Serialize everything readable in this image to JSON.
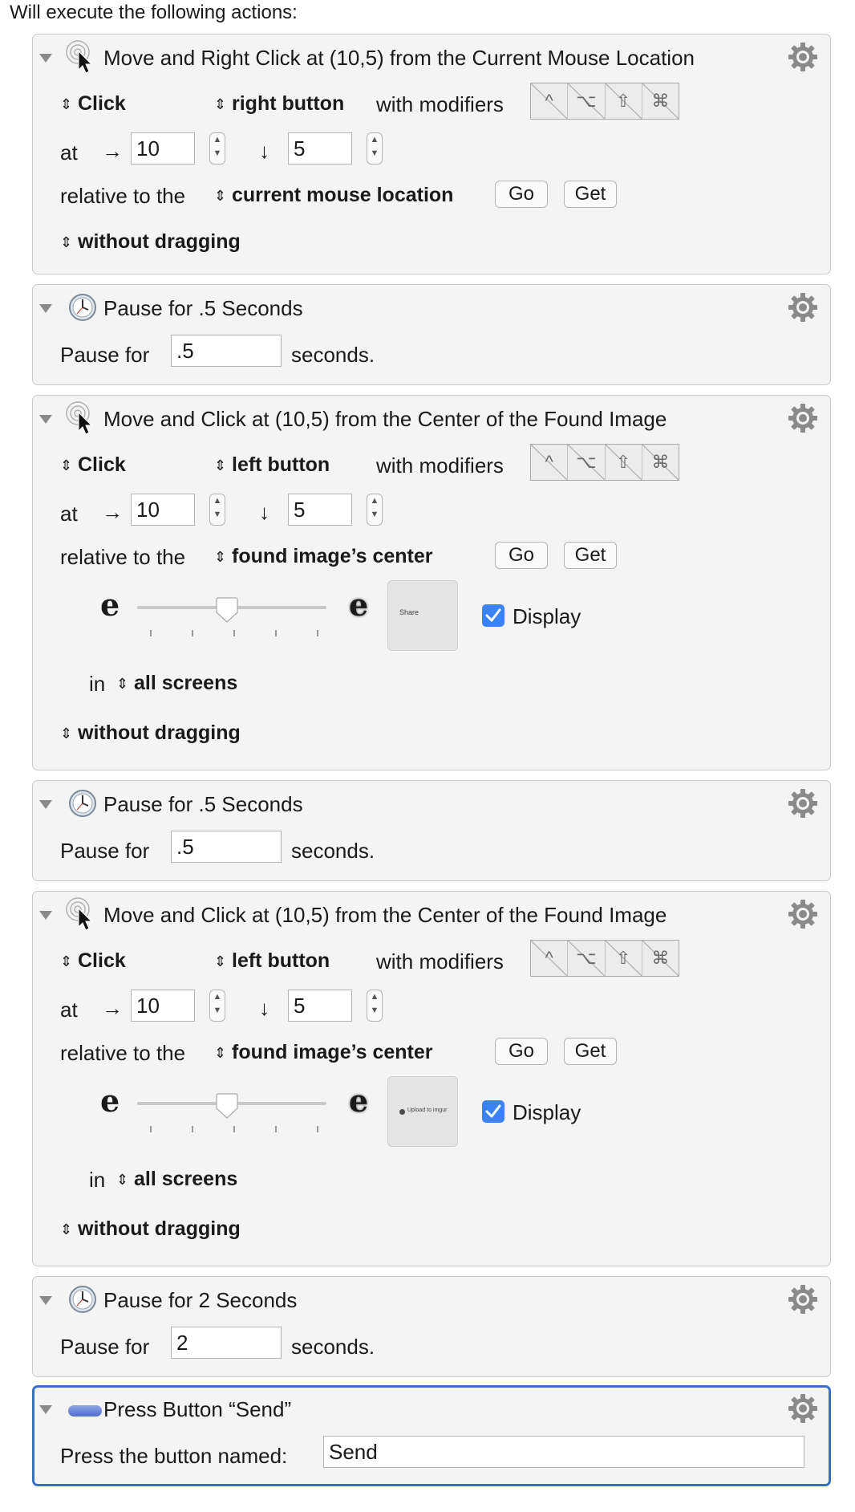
{
  "header": {
    "text": "Will execute the following actions:"
  },
  "actions": [
    {
      "title": "Move and Right Click at (10,5) from the Current Mouse Location",
      "click_mode": "Click",
      "button": "right button",
      "with_modifiers": "with modifiers",
      "modifiers": [
        "^",
        "⌥",
        "⇧",
        "⌘"
      ],
      "at_label": "at",
      "x_arrow": "→",
      "x_value": "10",
      "y_arrow": "↓",
      "y_value": "5",
      "relative_label": "relative to the",
      "relative_to": "current mouse location",
      "go": "Go",
      "get": "Get",
      "drag": "without dragging"
    },
    {
      "title": "Pause for .5 Seconds",
      "pause_label": "Pause for",
      "value": ".5",
      "unit": "seconds."
    },
    {
      "title": "Move and Click at (10,5) from the Center of the Found Image",
      "click_mode": "Click",
      "button": "left button",
      "with_modifiers": "with modifiers",
      "modifiers": [
        "^",
        "⌥",
        "⇧",
        "⌘"
      ],
      "at_label": "at",
      "x_arrow": "→",
      "x_value": "10",
      "y_arrow": "↓",
      "y_value": "5",
      "relative_label": "relative to the",
      "relative_to": "found image’s center",
      "go": "Go",
      "get": "Get",
      "fuzz_low": "e",
      "fuzz_high": "e",
      "image_text": "Share",
      "display_label": "Display",
      "display_checked": true,
      "in_label": "in",
      "screens": "all screens",
      "drag": "without dragging"
    },
    {
      "title": "Pause for .5 Seconds",
      "pause_label": "Pause for",
      "value": ".5",
      "unit": "seconds."
    },
    {
      "title": "Move and Click at (10,5) from the Center of the Found Image",
      "click_mode": "Click",
      "button": "left button",
      "with_modifiers": "with modifiers",
      "modifiers": [
        "^",
        "⌥",
        "⇧",
        "⌘"
      ],
      "at_label": "at",
      "x_arrow": "→",
      "x_value": "10",
      "y_arrow": "↓",
      "y_value": "5",
      "relative_label": "relative to the",
      "relative_to": "found image’s center",
      "go": "Go",
      "get": "Get",
      "fuzz_low": "e",
      "fuzz_high": "e",
      "image_text": "Upload to imgur",
      "display_label": "Display",
      "display_checked": true,
      "in_label": "in",
      "screens": "all screens",
      "drag": "without dragging"
    },
    {
      "title": "Pause for 2 Seconds",
      "pause_label": "Pause for",
      "value": "2",
      "unit": "seconds."
    },
    {
      "title": "Press Button “Send”",
      "press_label": "Press the button named:",
      "value": "Send"
    }
  ],
  "colors": {
    "selection_border": "#3a6fc6",
    "checkbox": "#3b82f6",
    "card_bg": "#f4f4f4"
  },
  "icons": {
    "collapse": "disclosure-triangle-icon",
    "click_action": "mouse-click-icon",
    "pause_action": "clock-icon",
    "button_action": "button-icon",
    "options": "gear-icon"
  }
}
